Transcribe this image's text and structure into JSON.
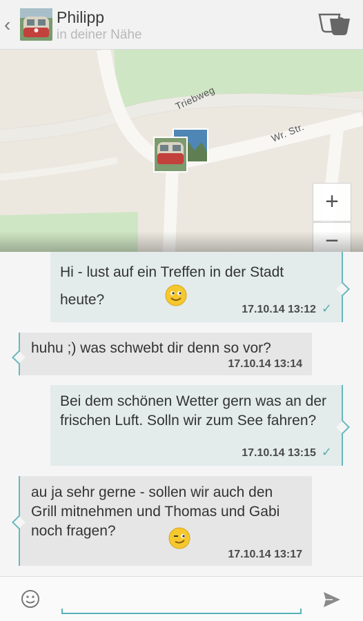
{
  "header": {
    "back_icon": "chevron-left-icon",
    "contact_name": "Philipp",
    "status": "in deiner Nähe",
    "action_icon": "coffee-cup-icon"
  },
  "map": {
    "street_1": "Triebweg",
    "street_2": "Wr. Str.",
    "zoom_in_label": "+",
    "zoom_out_label": "−"
  },
  "messages": [
    {
      "direction": "out",
      "text": "Hi - lust auf ein Treffen in der Stadt heute?",
      "emoji": "smile",
      "timestamp": "17.10.14 13:12",
      "status": "✓"
    },
    {
      "direction": "in",
      "text": "huhu ;) was schwebt dir denn so vor?",
      "timestamp": "17.10.14 13:14"
    },
    {
      "direction": "out",
      "text": "Bei dem schönen Wetter gern was an der frischen Luft. Solln wir zum See fahren?",
      "timestamp": "17.10.14 13:15",
      "status": "✓"
    },
    {
      "direction": "in",
      "text": "au ja sehr gerne - sollen wir auch den Grill mitnehmen und Thomas und Gabi noch fragen?",
      "emoji": "wink",
      "timestamp": "17.10.14 13:17"
    }
  ],
  "input": {
    "value": "",
    "emoji_icon": "smiley-icon",
    "send_icon": "send-icon"
  },
  "colors": {
    "accent": "#66b8bd",
    "outgoing_bubble": "#e3ebeb",
    "incoming_bubble": "#e6e6e6"
  }
}
